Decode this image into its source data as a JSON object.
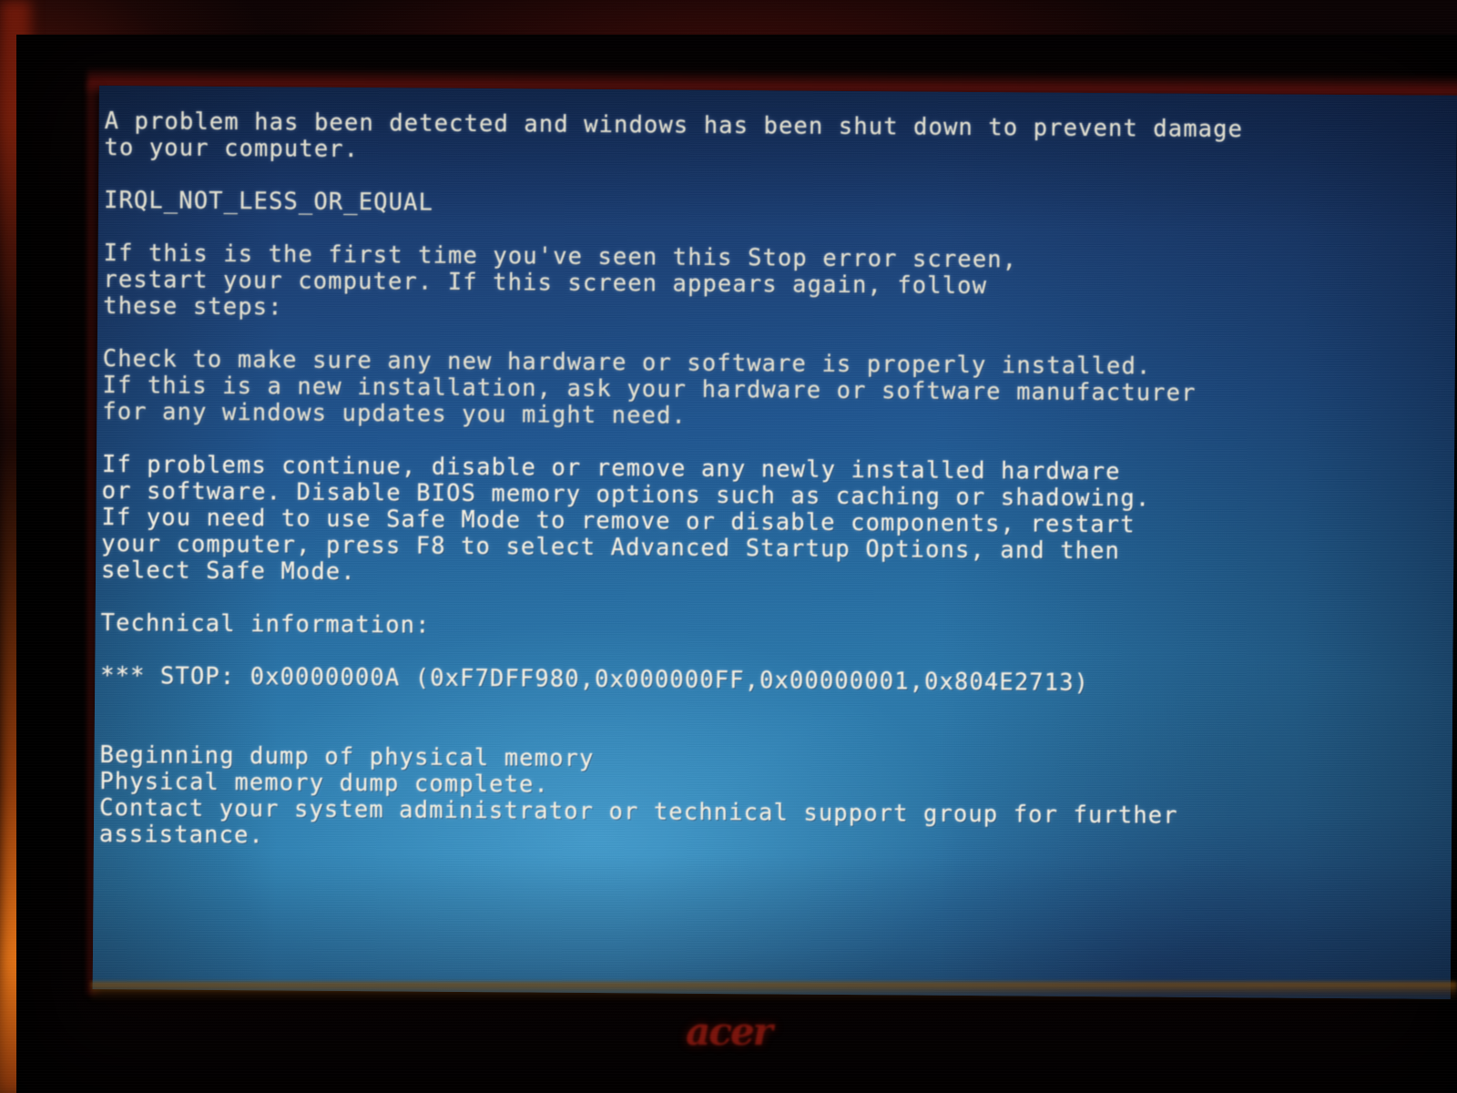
{
  "device": {
    "brand_logo": "acer",
    "bezel_color": "#050203",
    "screen_accent": "#2a79ab"
  },
  "bsod": {
    "background_color_top": "#13305f",
    "background_color_bottom": "#2d80b0",
    "text_color": "#f2efe2",
    "error_code": "IRQL_NOT_LESS_OR_EQUAL",
    "lines": [
      "A problem has been detected and windows has been shut down to prevent damage",
      "to your computer.",
      "",
      "IRQL_NOT_LESS_OR_EQUAL",
      "",
      "If this is the first time you've seen this Stop error screen,",
      "restart your computer. If this screen appears again, follow",
      "these steps:",
      "",
      "Check to make sure any new hardware or software is properly installed.",
      "If this is a new installation, ask your hardware or software manufacturer",
      "for any windows updates you might need.",
      "",
      "If problems continue, disable or remove any newly installed hardware",
      "or software. Disable BIOS memory options such as caching or shadowing.",
      "If you need to use Safe Mode to remove or disable components, restart",
      "your computer, press F8 to select Advanced Startup Options, and then",
      "select Safe Mode.",
      "",
      "Technical information:",
      "",
      "*** STOP: 0x0000000A (0xF7DFF980,0x000000FF,0x00000001,0x804E2713)",
      "",
      "",
      "Beginning dump of physical memory",
      "Physical memory dump complete.",
      "Contact your system administrator or technical support group for further",
      "assistance."
    ],
    "stop_code": "0x0000000A",
    "stop_parameters": [
      "0xF7DFF980",
      "0x000000FF",
      "0x00000001",
      "0x804E2713"
    ],
    "stop_line": "*** STOP: 0x0000000A (0xF7DFF980,0x000000FF,0x00000001,0x804E2713)",
    "technical_information_label": "Technical information:",
    "dump_status": [
      "Beginning dump of physical memory",
      "Physical memory dump complete."
    ],
    "support_message": "Contact your system administrator or technical support group for further assistance."
  }
}
